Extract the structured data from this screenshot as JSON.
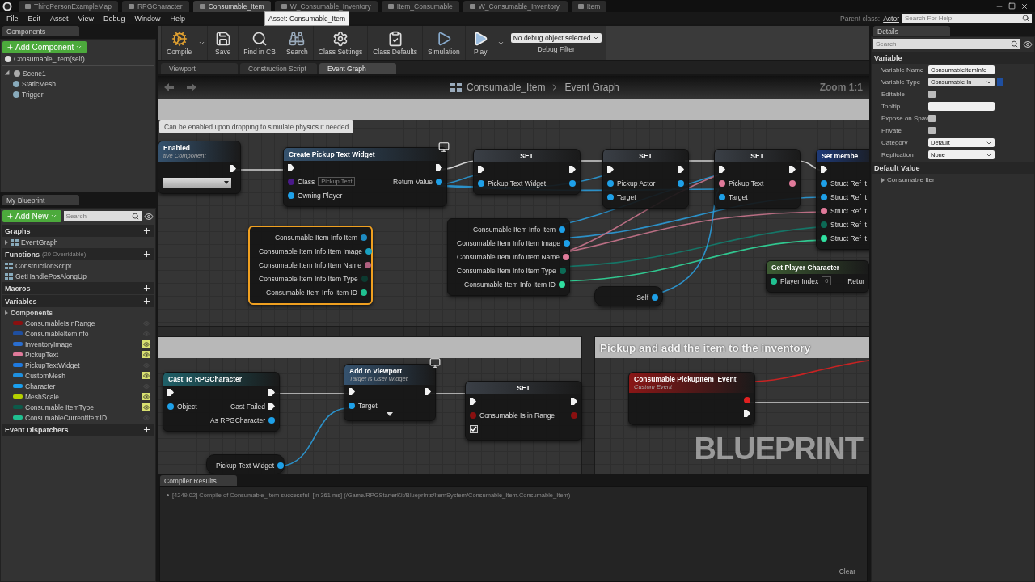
{
  "document_tabs": [
    {
      "label": "ThirdPersonExampleMap",
      "selected": false
    },
    {
      "label": "RPGCharacter",
      "selected": false
    },
    {
      "label": "Consumable_Item",
      "selected": true
    },
    {
      "label": "W_Consumable_Inventory",
      "selected": false
    },
    {
      "label": "Item_Consumable",
      "selected": false
    },
    {
      "label": "W_Consumable_Inventory.",
      "selected": false
    },
    {
      "label": "Item",
      "selected": false
    }
  ],
  "tooltip": "Asset: Consumable_Item",
  "menu": [
    "File",
    "Edit",
    "Asset",
    "View",
    "Debug",
    "Window",
    "Help"
  ],
  "parent_class": {
    "label": "Parent class:",
    "value": "Actor"
  },
  "help_search": {
    "placeholder": "Search For Help"
  },
  "components_panel": {
    "title": "Components",
    "add_button": "Add Component",
    "self_item": "Consumable_Item(self)",
    "tree": [
      {
        "label": "Scene1",
        "expanded": true,
        "children": [
          {
            "label": "StaticMesh"
          },
          {
            "label": "Trigger"
          }
        ]
      }
    ]
  },
  "my_blueprint": {
    "title": "My Blueprint",
    "add_button": "Add New",
    "search": {
      "placeholder": "Search"
    },
    "sections": [
      {
        "title": "Graphs",
        "items": [
          {
            "label": "EventGraph",
            "expanded": false
          }
        ]
      },
      {
        "title": "Functions",
        "note": "(20 Overridable)",
        "items": [
          {
            "label": "ConstructionScript"
          },
          {
            "label": "GetHandlePosAlongUp"
          }
        ]
      },
      {
        "title": "Macros"
      }
    ],
    "variables": {
      "title": "Variables",
      "category": {
        "label": "Components",
        "expanded": false
      },
      "items": [
        {
          "name": "ConsumableIsInRange",
          "color": "#8a1010",
          "public": false
        },
        {
          "name": "ConsumableItemInfo",
          "color": "#1f4fa0",
          "public": false
        },
        {
          "name": "InventoryImage",
          "color": "#2a6ed0",
          "public": true
        },
        {
          "name": "PickupText",
          "color": "#e07a9a",
          "public": true
        },
        {
          "name": "PickupTextWidget",
          "color": "#1e7ae0",
          "public": false
        },
        {
          "name": "CustomMesh",
          "color": "#1e90e0",
          "public": true
        },
        {
          "name": "Character",
          "color": "#1aa0f0",
          "public": false
        },
        {
          "name": "MeshScale",
          "color": "#b5d000",
          "public": true
        },
        {
          "name": "Consumable ItemType",
          "color": "#0c5a4a",
          "public": true
        },
        {
          "name": "ConsumableCurrentItemID",
          "color": "#20c090",
          "public": false
        }
      ]
    },
    "dispatchers_title": "Event Dispatchers"
  },
  "toolbar": [
    {
      "label": "Compile",
      "kind": "compile",
      "menu": true
    },
    {
      "label": "Save",
      "kind": "save",
      "menu": false
    },
    {
      "label": "Find in CB",
      "kind": "find",
      "menu": false
    },
    {
      "label": "Search",
      "kind": "search",
      "menu": false
    },
    {
      "label": "Class Settings",
      "kind": "settings",
      "menu": false
    },
    {
      "label": "Class Defaults",
      "kind": "defaults",
      "menu": false
    },
    {
      "label": "Simulation",
      "kind": "simulation",
      "menu": false
    },
    {
      "label": "Play",
      "kind": "play",
      "menu": true
    }
  ],
  "debug_filter": {
    "value": "No debug object selected",
    "label": "Debug Filter"
  },
  "graph_tabs": [
    {
      "label": "Viewport",
      "selected": false
    },
    {
      "label": "Construction Script",
      "selected": false
    },
    {
      "label": "Event Graph",
      "selected": true
    }
  ],
  "graph": {
    "breadcrumb": [
      "Consumable_Item",
      "Event Graph"
    ],
    "zoom": "Zoom 1:1",
    "note": "Can be enabled upon dropping to simulate physics if needed",
    "comment_title": "Pickup and add the item to the inventory",
    "watermark": "BLUEPRINT",
    "nodes": [
      {
        "kind": "function",
        "title": "Enabled",
        "subtitle": "tive Component",
        "selected": false,
        "rows": [
          {
            "right": {
              "kind": "exec"
            }
          },
          {
            "left": {
              "kind": "select"
            }
          }
        ]
      },
      {
        "kind": "function",
        "title": "Create Pickup Text Widget",
        "selected": false,
        "rows": [
          {
            "left": {
              "kind": "exec"
            },
            "right": {
              "kind": "exec"
            }
          },
          {
            "left": {
              "kind": "data",
              "label": "Class",
              "color": "#4a1a8a",
              "value": "Pickup Text"
            },
            "right": {
              "kind": "data",
              "label": "Return Value",
              "color": "#1ea0e8"
            }
          },
          {
            "left": {
              "kind": "data",
              "label": "Owning Player",
              "color": "#1ea0e8"
            }
          }
        ]
      },
      {
        "kind": "set",
        "title": "SET",
        "selected": false,
        "rows": [
          {
            "left": {
              "kind": "exec"
            },
            "right": {
              "kind": "exec"
            }
          },
          {
            "left": {
              "kind": "data",
              "label": "Pickup Text Widget",
              "color": "#1ea0e8"
            },
            "right": {
              "kind": "data",
              "color": "#1ea0e8"
            }
          }
        ]
      },
      {
        "kind": "set",
        "title": "SET",
        "selected": false,
        "rows": [
          {
            "left": {
              "kind": "exec"
            },
            "right": {
              "kind": "exec"
            }
          },
          {
            "left": {
              "kind": "data",
              "label": "Pickup Actor",
              "color": "#1ea0e8"
            },
            "right": {
              "kind": "data",
              "color": "#1ea0e8"
            }
          },
          {
            "left": {
              "kind": "data",
              "label": "Target",
              "color": "#1ea0e8"
            }
          }
        ]
      },
      {
        "kind": "set",
        "title": "SET",
        "selected": false,
        "rows": [
          {
            "left": {
              "kind": "exec"
            },
            "right": {
              "kind": "exec"
            }
          },
          {
            "left": {
              "kind": "data",
              "label": "Pickup Text",
              "color": "#e07a9a"
            },
            "right": {
              "kind": "data",
              "color": "#e07a9a"
            }
          },
          {
            "left": {
              "kind": "data",
              "label": "Target",
              "color": "#1ea0e8"
            }
          }
        ]
      },
      {
        "kind": "struct",
        "title": "Set membe",
        "selected": false,
        "rows": [
          {
            "left": {
              "kind": "exec"
            }
          },
          {
            "left": {
              "kind": "data",
              "label": "Struct Ref It",
              "color": "#1ea0e8"
            }
          },
          {
            "left": {
              "kind": "data",
              "label": "Struct Ref It",
              "color": "#1ea0e8"
            }
          },
          {
            "left": {
              "kind": "data",
              "label": "Struct Ref It",
              "color": "#e07a9a"
            }
          },
          {
            "left": {
              "kind": "data",
              "label": "Struct Ref It",
              "color": "#0c6a55"
            }
          },
          {
            "left": {
              "kind": "data",
              "label": "Struct Ref It",
              "color": "#30e0a0"
            }
          }
        ]
      },
      {
        "kind": "break",
        "selected": true,
        "rows": [
          {
            "right": {
              "kind": "data",
              "label": "Consumable Item Info Item",
              "color": "#1e8ac0"
            }
          },
          {
            "right": {
              "kind": "data",
              "label": "Consumable Item Info Item Image",
              "color": "#1aa0c0"
            }
          },
          {
            "right": {
              "kind": "data",
              "label": "Consumable Item Info Item Name",
              "color": "#b06080"
            }
          },
          {
            "right": {
              "kind": "data",
              "label": "Consumable Item Info Item Type",
              "color": "#0c3a30"
            }
          },
          {
            "right": {
              "kind": "data",
              "label": "Consumable Item Info Item ID",
              "color": "#20c090"
            }
          }
        ]
      },
      {
        "kind": "break",
        "selected": false,
        "rows": [
          {
            "right": {
              "kind": "data",
              "label": "Consumable Item Info Item",
              "color": "#1ea0e8"
            }
          },
          {
            "right": {
              "kind": "data",
              "label": "Consumable Item Info Item Image",
              "color": "#1ea0e8"
            }
          },
          {
            "right": {
              "kind": "data",
              "label": "Consumable Item Info Item Name",
              "color": "#e07a9a"
            }
          },
          {
            "right": {
              "kind": "data",
              "label": "Consumable Item Info Item Type",
              "color": "#0c6a55"
            }
          },
          {
            "right": {
              "kind": "data",
              "label": "Consumable Item Info Item ID",
              "color": "#30e0a0"
            }
          }
        ]
      },
      {
        "kind": "getter",
        "selected": false,
        "rows": [
          {
            "right": {
              "kind": "data",
              "label": "Self",
              "color": "#1ea0e8"
            }
          }
        ]
      },
      {
        "kind": "pure",
        "title": "Get Player Character",
        "selected": false,
        "rows": [
          {
            "left": {
              "kind": "data",
              "label": "Player Index",
              "color": "#20c090",
              "value": "0"
            },
            "right": {
              "kind": "data",
              "label": "Retur"
            }
          }
        ]
      },
      {
        "kind": "cast",
        "title": "Cast To RPGCharacter",
        "selected": false,
        "rows": [
          {
            "left": {
              "kind": "exec"
            },
            "right": {
              "kind": "exec"
            }
          },
          {
            "left": {
              "kind": "data",
              "label": "Object",
              "color": "#1ea0e8"
            },
            "right": {
              "kind": "exec",
              "label": "Cast Failed"
            }
          },
          {
            "right": {
              "kind": "data",
              "label": "As RPGCharacter",
              "color": "#1ea0e8"
            }
          }
        ]
      },
      {
        "kind": "function",
        "title": "Add to Viewport",
        "subtitle": "Target is User Widget",
        "selected": false,
        "advanced": true,
        "rows": [
          {
            "left": {
              "kind": "exec"
            },
            "right": {
              "kind": "exec"
            }
          },
          {
            "left": {
              "kind": "data",
              "label": "Target",
              "color": "#1ea0e8"
            }
          }
        ]
      },
      {
        "kind": "set",
        "title": "SET",
        "selected": false,
        "rows": [
          {
            "left": {
              "kind": "exec"
            },
            "right": {
              "kind": "exec"
            }
          },
          {
            "left": {
              "kind": "data",
              "label": "Consumable Is in Range",
              "color": "#8a1010"
            },
            "right": {
              "kind": "data",
              "color": "#8a1010"
            }
          },
          {
            "left": {
              "kind": "check",
              "checked": true
            }
          }
        ]
      },
      {
        "kind": "getter",
        "selected": false,
        "rows": [
          {
            "right": {
              "kind": "data",
              "label": "Pickup Text Widget",
              "color": "#1ea0e8"
            }
          }
        ]
      },
      {
        "kind": "event",
        "title": "Consumable PickupItem_Event",
        "subtitle": "Custom Event",
        "selected": false,
        "rows": [
          {
            "right": {
              "kind": "data",
              "color": "#e02020"
            }
          },
          {
            "right": {
              "kind": "exec"
            }
          }
        ]
      }
    ]
  },
  "compiler": {
    "title": "Compiler Results",
    "messages": [
      "[4249.02] Compile of Consumable_Item successful! [in 361 ms] (/Game/RPGStarterKit/Blueprints/ItemSystem/Consumable_Item.Consumable_Item)"
    ],
    "clear_button": "Clear"
  },
  "details": {
    "title": "Details",
    "search": {
      "placeholder": "Search"
    },
    "sections": [
      {
        "title": "Variable",
        "rows": [
          {
            "label": "Variable Name",
            "kind": "text",
            "value": "ConsumableItemInfo"
          },
          {
            "label": "Variable Type",
            "kind": "type",
            "value": "Consumable In"
          },
          {
            "label": "Editable",
            "kind": "checkbox",
            "checked": false
          },
          {
            "label": "Tooltip",
            "kind": "text"
          },
          {
            "label": "Expose on Spaw",
            "kind": "checkbox",
            "checked": false
          },
          {
            "label": "Private",
            "kind": "checkbox",
            "checked": false
          },
          {
            "label": "Category",
            "kind": "dropdown",
            "value": "Default"
          },
          {
            "label": "Replication",
            "kind": "dropdown",
            "value": "None"
          }
        ]
      },
      {
        "title": "Default Value",
        "rows": [
          {
            "label": "Consumable Iter",
            "kind": "tree"
          }
        ]
      }
    ]
  }
}
